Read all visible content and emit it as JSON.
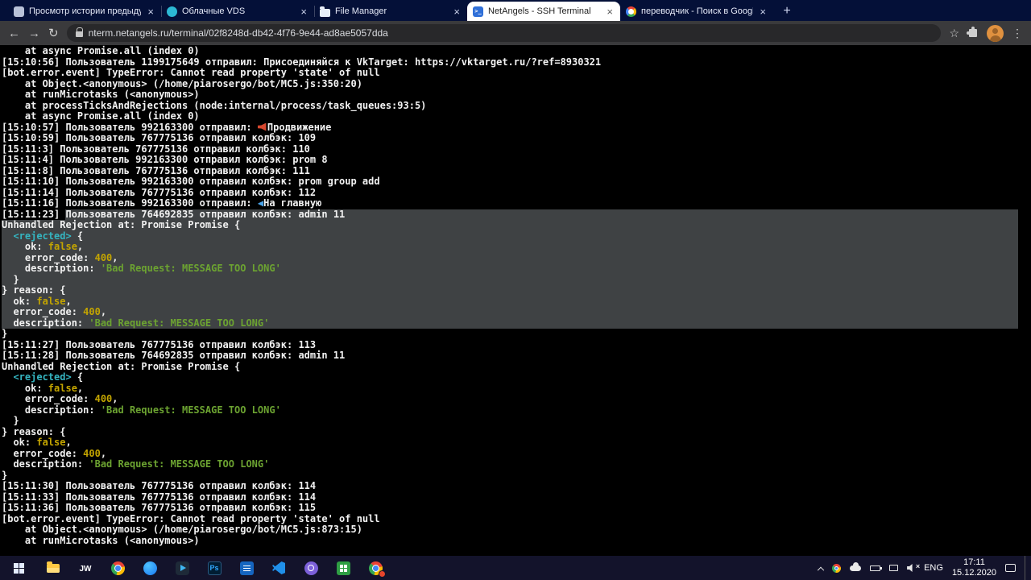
{
  "browser": {
    "url": "nterm.netangels.ru/terminal/02f8248d-db42-4f76-9e44-ad8ae5057dda",
    "tabs": [
      {
        "id": "history",
        "icon": "history-favicon",
        "title": "Просмотр истории предыдущи",
        "active": false
      },
      {
        "id": "cloud",
        "icon": "cloud-favicon",
        "title": "Облачные VDS",
        "active": false
      },
      {
        "id": "files",
        "icon": "folder-favicon",
        "title": "File Manager",
        "active": false
      },
      {
        "id": "terminal",
        "icon": "terminal-favicon",
        "title": "NetAngels - SSH Terminal",
        "active": true
      },
      {
        "id": "google",
        "icon": "google-favicon",
        "title": "переводчик - Поиск в Google",
        "active": false
      }
    ]
  },
  "icons": {
    "back": "←",
    "forward": "→",
    "reload": "↻",
    "star": "☆",
    "kebab": "⋮",
    "new_tab": "+",
    "tab_close": "×"
  },
  "colors": {
    "tabbar_bg": "#041038",
    "toolbar_bg": "#3a3a3c",
    "terminal_bg": "#000000",
    "terminal_text": "#f2f2f2",
    "selection_bg": "#3f4244",
    "cyan": "#35b5c1",
    "yellow": "#c4a500",
    "green": "#6ca331",
    "emoji_blue": "#4aa3e8",
    "emoji_red": "#d6482f"
  },
  "terminal": {
    "lines": [
      {
        "sel": 0,
        "seg": [
          {
            "t": "    at async Promise.all (index 0)"
          }
        ]
      },
      {
        "sel": 0,
        "seg": [
          {
            "t": "[15:10:56] Пользователь 1199175649 отправил: Присоединяйся к VkTarget: https://vktarget.ru/?ref=8930321"
          }
        ]
      },
      {
        "sel": 0,
        "seg": [
          {
            "t": "[bot.error.event] TypeError: Cannot read property 'state' of null"
          }
        ]
      },
      {
        "sel": 0,
        "seg": [
          {
            "t": "    at Object.<anonymous> (/home/piarosergo/bot/MC5.js:350:20)"
          }
        ]
      },
      {
        "sel": 0,
        "seg": [
          {
            "t": "    at runMicrotasks (<anonymous>)"
          }
        ]
      },
      {
        "sel": 0,
        "seg": [
          {
            "t": "    at processTicksAndRejections (node:internal/process/task_queues:93:5)"
          }
        ]
      },
      {
        "sel": 0,
        "seg": [
          {
            "t": "    at async Promise.all (index 0)"
          }
        ]
      },
      {
        "sel": 0,
        "seg": [
          {
            "t": "[15:10:57] Пользователь 992163300 отправил: "
          },
          {
            "i": "megaphone"
          },
          {
            "t": "Продвижение"
          }
        ]
      },
      {
        "sel": 0,
        "seg": [
          {
            "t": "[15:10:59] Пользователь 767775136 отправил колбэк: 109"
          }
        ]
      },
      {
        "sel": 0,
        "seg": [
          {
            "t": "[15:11:3] Пользователь 767775136 отправил колбэк: 110"
          }
        ]
      },
      {
        "sel": 0,
        "seg": [
          {
            "t": "[15:11:4] Пользователь 992163300 отправил колбэк: prom 8"
          }
        ]
      },
      {
        "sel": 0,
        "seg": [
          {
            "t": "[15:11:8] Пользователь 767775136 отправил колбэк: 111"
          }
        ]
      },
      {
        "sel": 0,
        "seg": [
          {
            "t": "[15:11:10] Пользователь 992163300 отправил колбэк: prom group add"
          }
        ]
      },
      {
        "sel": 0,
        "seg": [
          {
            "t": "[15:11:14] Пользователь 767775136 отправил колбэк: 112"
          }
        ]
      },
      {
        "sel": 0,
        "seg": [
          {
            "t": "[15:11:16] Пользователь 992163300 отправил: "
          },
          {
            "t": "◀",
            "c": "b"
          },
          {
            "t": "На главную"
          }
        ]
      },
      {
        "sel": 2,
        "seg": [
          {
            "t": "[15:11:23] "
          },
          {
            "t": "Пользователь 764692835 отправил колбэк: admin 11",
            "s": 1
          }
        ]
      },
      {
        "sel": 1,
        "seg": [
          {
            "t": "Unhandled Rejection at: Promise Promise {"
          }
        ]
      },
      {
        "sel": 1,
        "seg": [
          {
            "t": "  "
          },
          {
            "t": "<rejected>",
            "c": "c"
          },
          {
            "t": " {"
          }
        ]
      },
      {
        "sel": 1,
        "seg": [
          {
            "t": "    ok: "
          },
          {
            "t": "false",
            "c": "y"
          },
          {
            "t": ","
          }
        ]
      },
      {
        "sel": 1,
        "seg": [
          {
            "t": "    error_code: "
          },
          {
            "t": "400",
            "c": "y"
          },
          {
            "t": ","
          }
        ]
      },
      {
        "sel": 1,
        "seg": [
          {
            "t": "    description: "
          },
          {
            "t": "'Bad Request: MESSAGE TOO LONG'",
            "c": "g"
          }
        ]
      },
      {
        "sel": 1,
        "seg": [
          {
            "t": "  }"
          }
        ]
      },
      {
        "sel": 1,
        "seg": [
          {
            "t": "} reason: {"
          }
        ]
      },
      {
        "sel": 1,
        "seg": [
          {
            "t": "  ok: "
          },
          {
            "t": "false",
            "c": "y"
          },
          {
            "t": ","
          }
        ]
      },
      {
        "sel": 1,
        "seg": [
          {
            "t": "  error_code: "
          },
          {
            "t": "400",
            "c": "y"
          },
          {
            "t": ","
          }
        ]
      },
      {
        "sel": 1,
        "seg": [
          {
            "t": "  description: "
          },
          {
            "t": "'Bad Request: MESSAGE TOO LONG'",
            "c": "g"
          }
        ]
      },
      {
        "sel": 0,
        "seg": [
          {
            "t": "}"
          }
        ]
      },
      {
        "sel": 0,
        "seg": [
          {
            "t": "[15:11:27] Пользователь 767775136 отправил колбэк: 113"
          }
        ]
      },
      {
        "sel": 0,
        "seg": [
          {
            "t": "[15:11:28] Пользователь 764692835 отправил колбэк: admin 11"
          }
        ]
      },
      {
        "sel": 0,
        "seg": [
          {
            "t": "Unhandled Rejection at: Promise Promise {"
          }
        ]
      },
      {
        "sel": 0,
        "seg": [
          {
            "t": "  "
          },
          {
            "t": "<rejected>",
            "c": "c"
          },
          {
            "t": " {"
          }
        ]
      },
      {
        "sel": 0,
        "seg": [
          {
            "t": "    ok: "
          },
          {
            "t": "false",
            "c": "y"
          },
          {
            "t": ","
          }
        ]
      },
      {
        "sel": 0,
        "seg": [
          {
            "t": "    error_code: "
          },
          {
            "t": "400",
            "c": "y"
          },
          {
            "t": ","
          }
        ]
      },
      {
        "sel": 0,
        "seg": [
          {
            "t": "    description: "
          },
          {
            "t": "'Bad Request: MESSAGE TOO LONG'",
            "c": "g"
          }
        ]
      },
      {
        "sel": 0,
        "seg": [
          {
            "t": "  }"
          }
        ]
      },
      {
        "sel": 0,
        "seg": [
          {
            "t": "} reason: {"
          }
        ]
      },
      {
        "sel": 0,
        "seg": [
          {
            "t": "  ok: "
          },
          {
            "t": "false",
            "c": "y"
          },
          {
            "t": ","
          }
        ]
      },
      {
        "sel": 0,
        "seg": [
          {
            "t": "  error_code: "
          },
          {
            "t": "400",
            "c": "y"
          },
          {
            "t": ","
          }
        ]
      },
      {
        "sel": 0,
        "seg": [
          {
            "t": "  description: "
          },
          {
            "t": "'Bad Request: MESSAGE TOO LONG'",
            "c": "g"
          }
        ]
      },
      {
        "sel": 0,
        "seg": [
          {
            "t": "}"
          }
        ]
      },
      {
        "sel": 0,
        "seg": [
          {
            "t": "[15:11:30] Пользователь 767775136 отправил колбэк: 114"
          }
        ]
      },
      {
        "sel": 0,
        "seg": [
          {
            "t": "[15:11:33] Пользователь 767775136 отправил колбэк: 114"
          }
        ]
      },
      {
        "sel": 0,
        "seg": [
          {
            "t": "[15:11:36] Пользователь 767775136 отправил колбэк: 115"
          }
        ]
      },
      {
        "sel": 0,
        "seg": [
          {
            "t": "[bot.error.event] TypeError: Cannot read property 'state' of null"
          }
        ]
      },
      {
        "sel": 0,
        "seg": [
          {
            "t": "    at Object.<anonymous> (/home/piarosergo/bot/MC5.js:873:15)"
          }
        ]
      },
      {
        "sel": 0,
        "seg": [
          {
            "t": "    at runMicrotasks (<anonymous>)"
          }
        ]
      }
    ]
  },
  "taskbar": {
    "apps": [
      {
        "id": "start"
      },
      {
        "id": "explorer"
      },
      {
        "id": "jw-library"
      },
      {
        "id": "chrome"
      },
      {
        "id": "messenger"
      },
      {
        "id": "telegram"
      },
      {
        "id": "photoshop"
      },
      {
        "id": "blue-app"
      },
      {
        "id": "vscode"
      },
      {
        "id": "viber"
      },
      {
        "id": "green-app"
      },
      {
        "id": "chrome-badged"
      }
    ],
    "tray": {
      "lang": "ENG",
      "time": "17:11",
      "date": "15.12.2020"
    }
  }
}
